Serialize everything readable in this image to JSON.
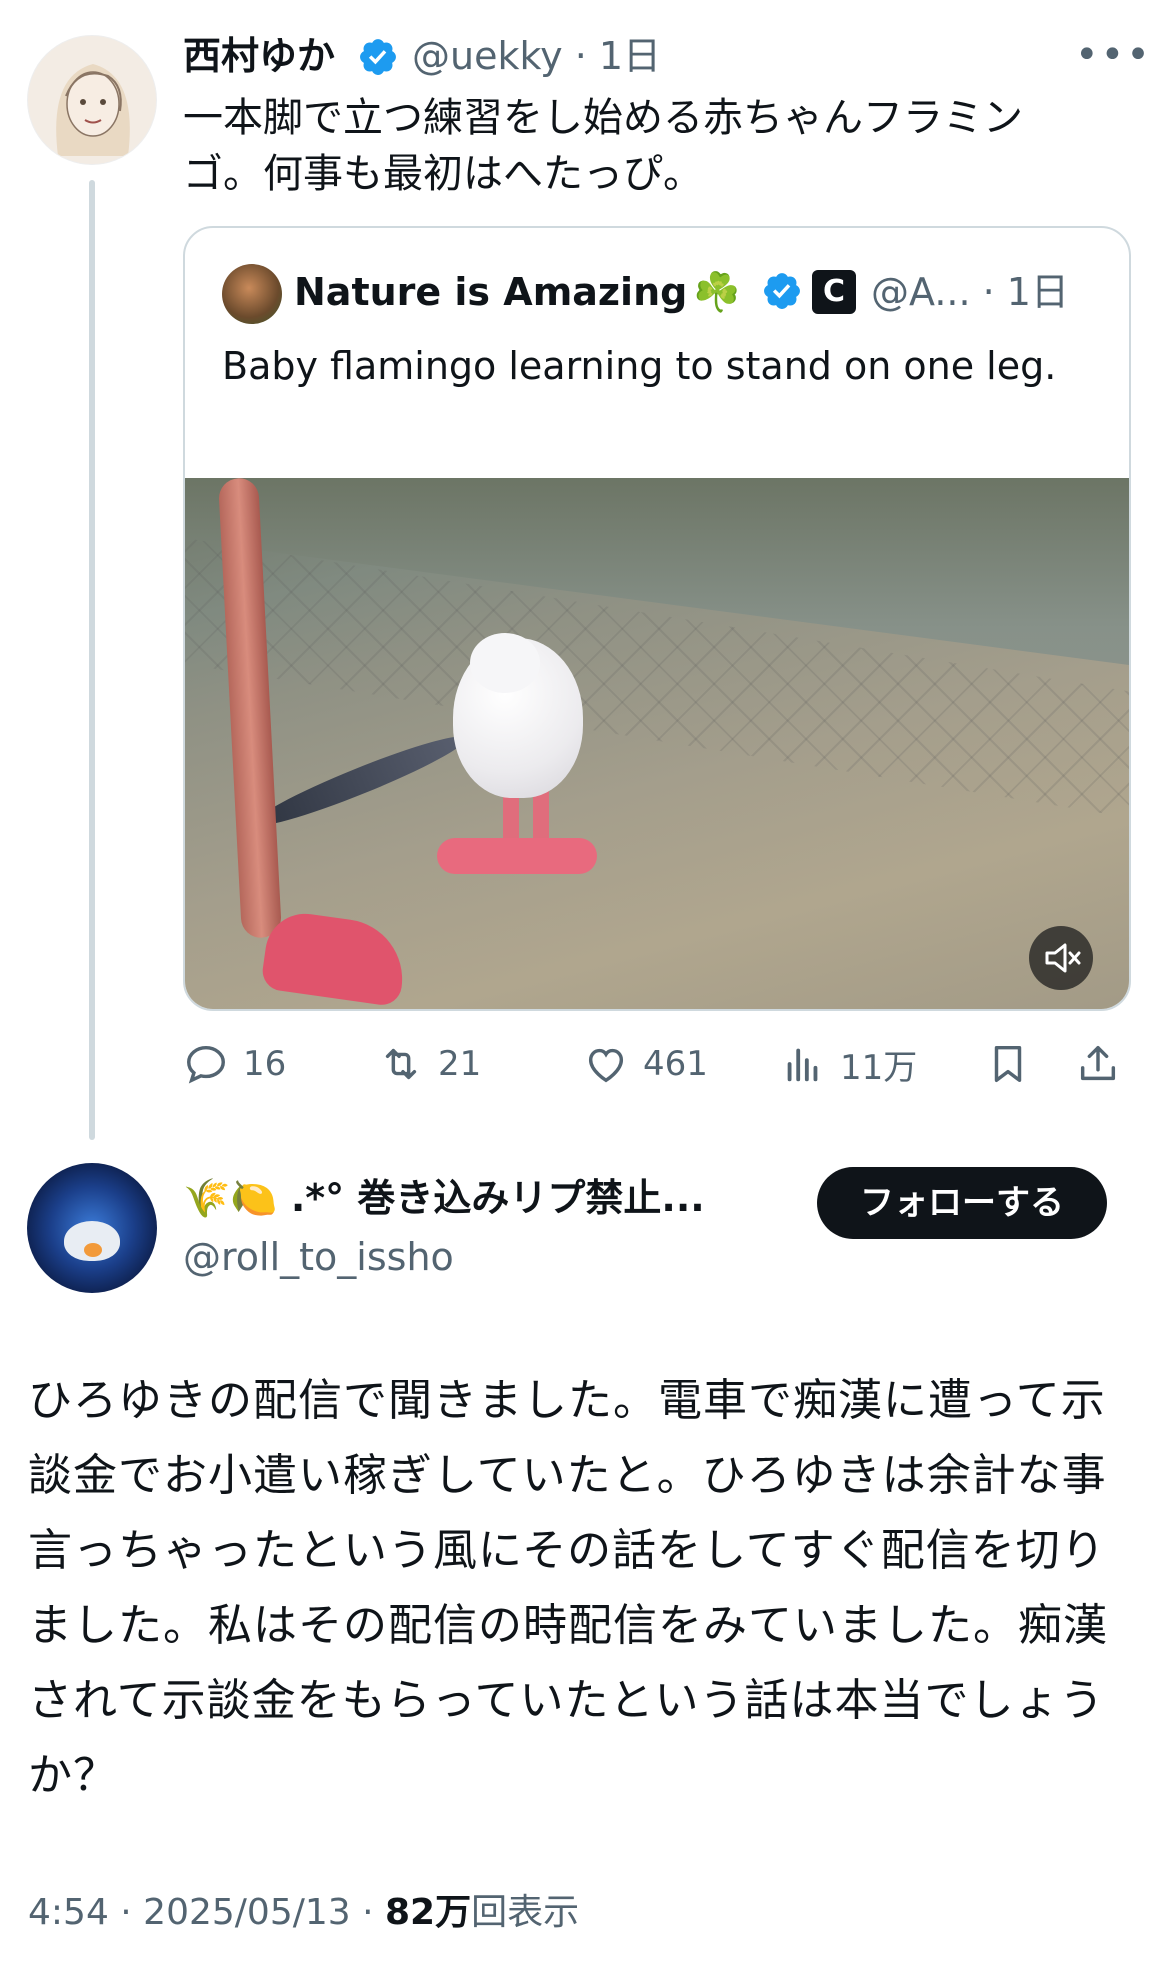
{
  "parent_tweet": {
    "author_name": "西村ゆか",
    "handle_time": "@uekky · 1日",
    "more_label": "•••",
    "text": "一本脚で立つ練習をし始める赤ちゃんフラミンゴ。何事も最初はへたっぴ。",
    "quote": {
      "author_name": "Nature is Amazing",
      "clover": "☘️",
      "badge_letter": "C",
      "handle_time": "@A... · 1日",
      "text": "Baby flamingo learning to stand on one leg."
    },
    "actions": {
      "replies": "16",
      "retweets": "21",
      "likes": "461",
      "views": "11万"
    }
  },
  "reply_tweet": {
    "author_name": "🌾🍋 .*° 巻き込みリプ禁止...",
    "handle": "@roll_to_issho",
    "follow_label": "フォローする",
    "text": "ひろゆきの配信で聞きました。電車で痴漢に遭って示談金でお小遣い稼ぎしていたと。ひろゆきは余計な事言っちゃったという風にその話をしてすぐ配信を切りました。私はその配信の時配信をみていました。痴漢されて示談金をもらっていたという話は本当でしょうか？",
    "time_date": "4:54 · 2025/05/13 · ",
    "view_count": "82万",
    "view_label": "回表示"
  },
  "colors": {
    "verified": "#1d9bf0",
    "muted_text": "#536471",
    "primary_text": "#0f1419",
    "border": "#cfd9de"
  },
  "icons": [
    "reply-icon",
    "retweet-icon",
    "like-icon",
    "views-icon",
    "bookmark-icon",
    "share-icon",
    "mute-icon",
    "verified-icon",
    "more-icon"
  ]
}
